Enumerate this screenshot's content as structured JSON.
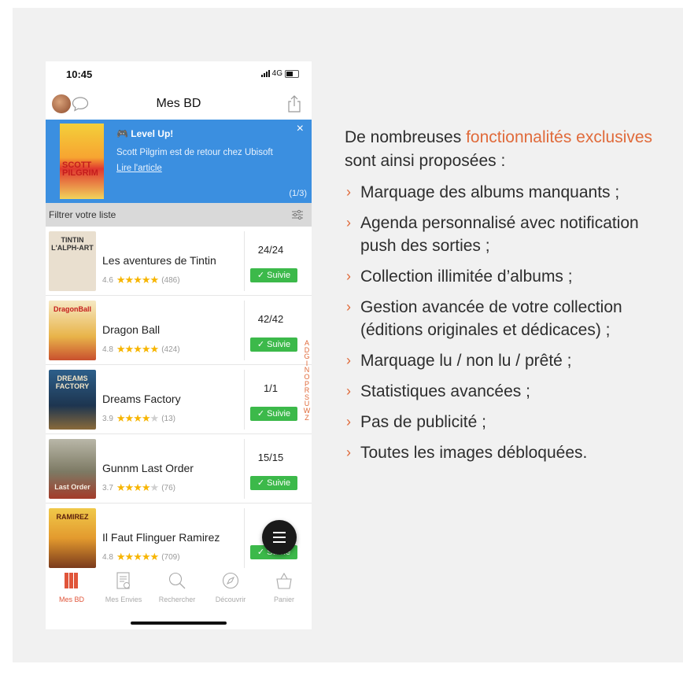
{
  "status_bar": {
    "time": "10:45",
    "network": "4G"
  },
  "nav": {
    "title": "Mes BD"
  },
  "banner": {
    "tag": "🎮 Level Up!",
    "text": "Scott Pilgrim est de retour chez Ubisoft",
    "link": "Lire l'article",
    "counter": "(1/3)",
    "close": "×",
    "cover_title": "SCOTT PILGRIM"
  },
  "filter": {
    "label": "Filtrer votre liste"
  },
  "albums": [
    {
      "title": "Les aventures de Tintin",
      "rating": "4.6",
      "stars": 4.5,
      "reviews": "(486)",
      "count": "24/24",
      "status": "✓ Suivie",
      "cover_text": "TINTIN L'ALPH-ART"
    },
    {
      "title": "Dragon Ball",
      "rating": "4.8",
      "stars": 4.5,
      "reviews": "(424)",
      "count": "42/42",
      "status": "✓ Suivie",
      "cover_text": "DragonBall"
    },
    {
      "title": "Dreams Factory",
      "rating": "3.9",
      "stars": 3.5,
      "reviews": "(13)",
      "count": "1/1",
      "status": "✓ Suivie",
      "cover_text": "DREAMS FACTORY"
    },
    {
      "title": "Gunnm Last Order",
      "rating": "3.7",
      "stars": 3.5,
      "reviews": "(76)",
      "count": "15/15",
      "status": "✓ Suivie",
      "cover_text": "Last Order"
    },
    {
      "title": "Il Faut Flinguer Ramirez",
      "rating": "4.8",
      "stars": 4.5,
      "reviews": "(709)",
      "count": "",
      "status": "✓ Suivie",
      "cover_text": "RAMIREZ"
    }
  ],
  "alphabet": [
    "A",
    "D",
    "G",
    "I",
    "N",
    "O",
    "P",
    "R",
    "S",
    "U",
    "W",
    "Z"
  ],
  "tabs": [
    {
      "label": "Mes BD",
      "icon": "books-icon",
      "active": true
    },
    {
      "label": "Mes Envies",
      "icon": "wishlist-icon",
      "active": false
    },
    {
      "label": "Rechercher",
      "icon": "search-icon",
      "active": false
    },
    {
      "label": "Découvrir",
      "icon": "compass-icon",
      "active": false
    },
    {
      "label": "Panier",
      "icon": "basket-icon",
      "active": false
    }
  ],
  "description": {
    "intro_before": "De nombreuses ",
    "intro_highlight": "fonctionnalités exclusives",
    "intro_after": " sont ainsi proposées :",
    "features": [
      "Marquage des albums manquants ;",
      "Agenda personnalisé avec notification push des sorties ;",
      "Collection illimitée d’albums ;",
      "Gestion avancée de votre collection (éditions originales et dédicaces) ;",
      "Marquage lu / non lu / prêté ;",
      "Statistiques avancées ;",
      "Pas de publicité ;",
      "Toutes les images débloquées."
    ]
  },
  "colors": {
    "accent": "#e06a3a",
    "banner": "#3b8fe0",
    "follow": "#3cb94a",
    "star": "#f7b500"
  }
}
